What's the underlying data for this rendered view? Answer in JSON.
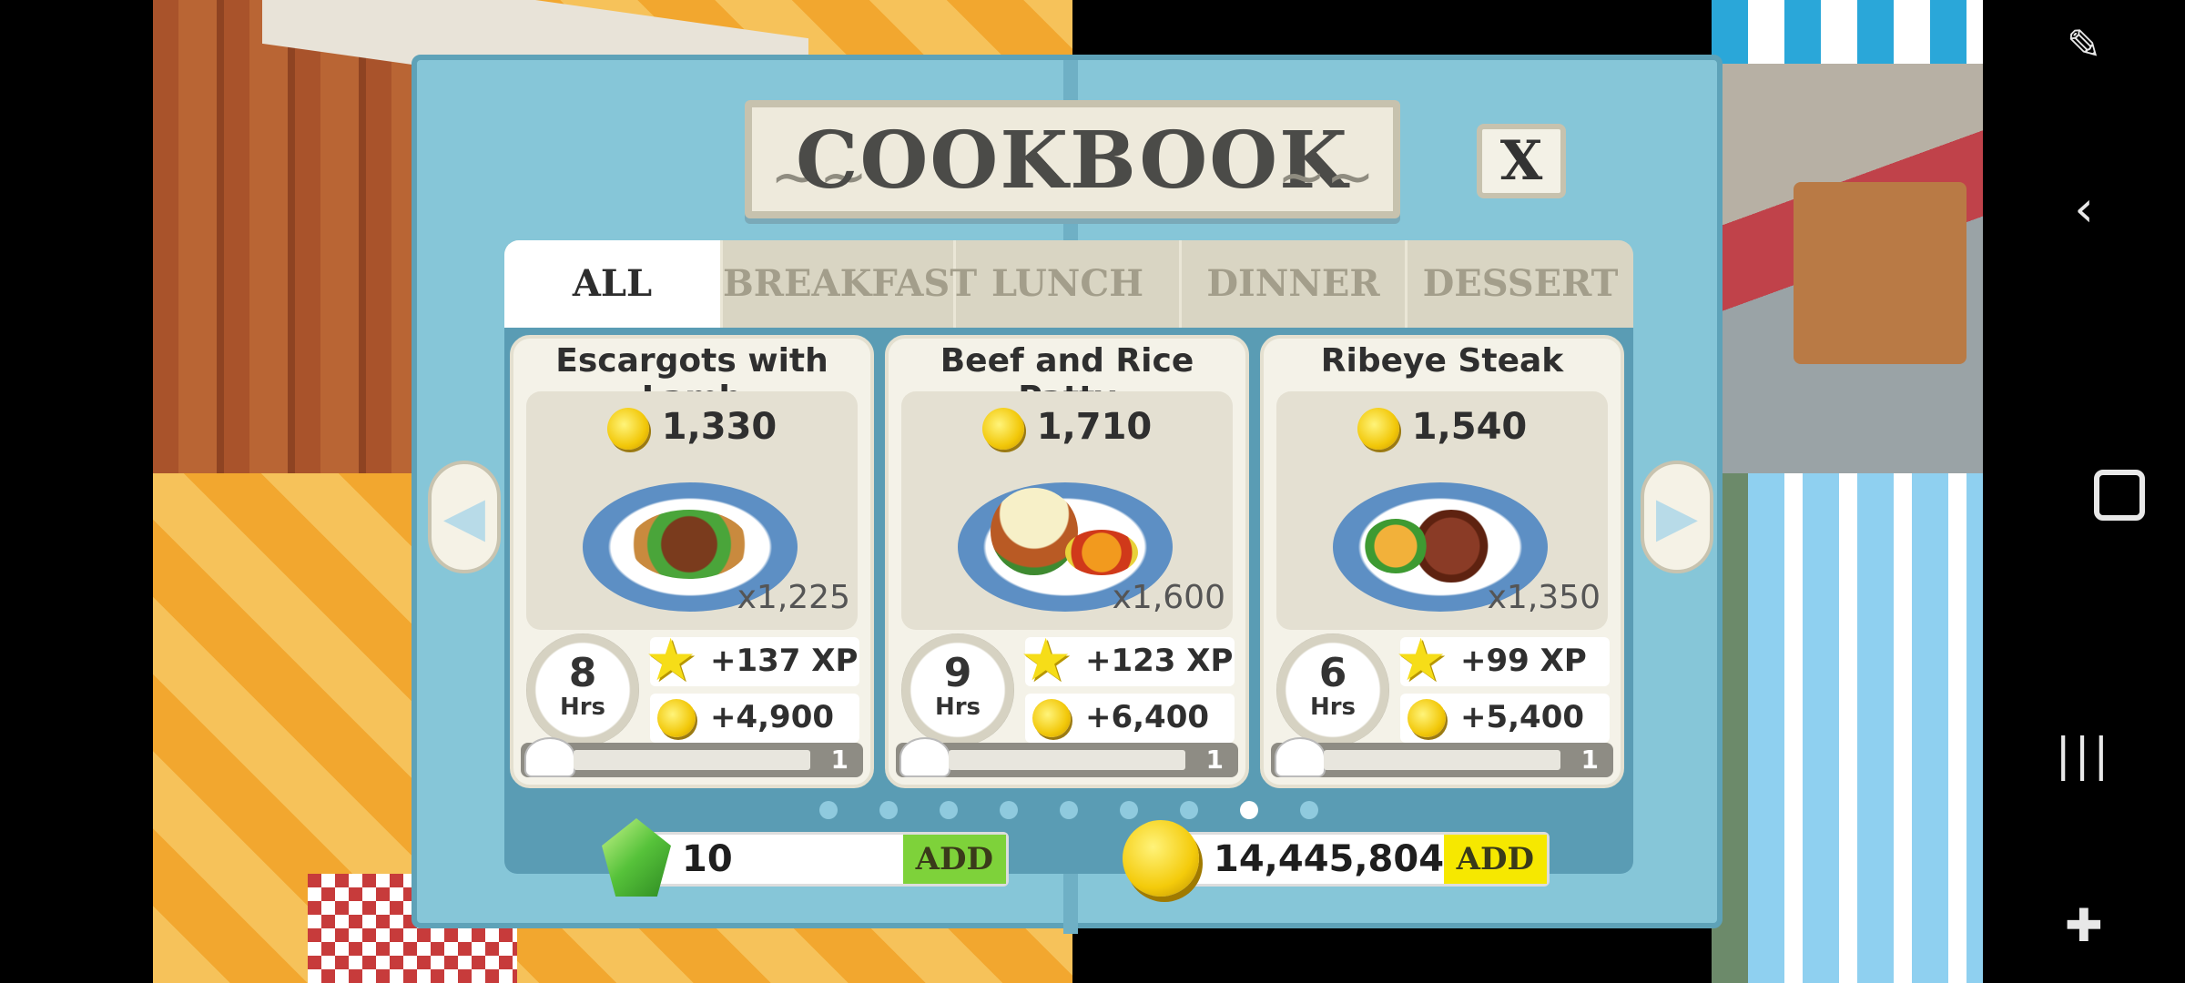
{
  "dialog": {
    "title": "COOKBOOK",
    "close_label": "X"
  },
  "tabs": [
    {
      "label": "ALL",
      "active": true
    },
    {
      "label": "BREAKFAST",
      "active": false
    },
    {
      "label": "LUNCH",
      "active": false
    },
    {
      "label": "DINNER",
      "active": false
    },
    {
      "label": "DESSERT",
      "active": false
    }
  ],
  "recipes": [
    {
      "name": "Escargots with Lamb",
      "cost": "1,330",
      "servings": "x1,225",
      "hours": "8",
      "hours_unit": "Hrs",
      "xp": "+137 XP",
      "coins": "+4,900",
      "level": "1"
    },
    {
      "name": "Beef and Rice Patty",
      "cost": "1,710",
      "servings": "x1,600",
      "hours": "9",
      "hours_unit": "Hrs",
      "xp": "+123 XP",
      "coins": "+6,400",
      "level": "1"
    },
    {
      "name": "Ribeye Steak",
      "cost": "1,540",
      "servings": "x1,350",
      "hours": "6",
      "hours_unit": "Hrs",
      "xp": "+99 XP",
      "coins": "+5,400",
      "level": "1"
    }
  ],
  "pagination": {
    "total": 9,
    "current": 8
  },
  "currency": {
    "gems": "10",
    "gems_add": "ADD",
    "coins": "14,445,804",
    "coins_add": "ADD"
  },
  "icons": {
    "coin": "coin-icon",
    "star": "star-icon",
    "gem": "gem-icon",
    "timer": "clock-icon",
    "chef_hat": "chef-hat-icon"
  },
  "colors": {
    "dialog_bg": "#86c6d8",
    "panel_bg": "#5a9cb4",
    "coin_gold": "#f2c80a",
    "gem_green": "#56c23a",
    "coin_add_yellow": "#f6e800",
    "gem_add_green": "#7ed23a"
  }
}
